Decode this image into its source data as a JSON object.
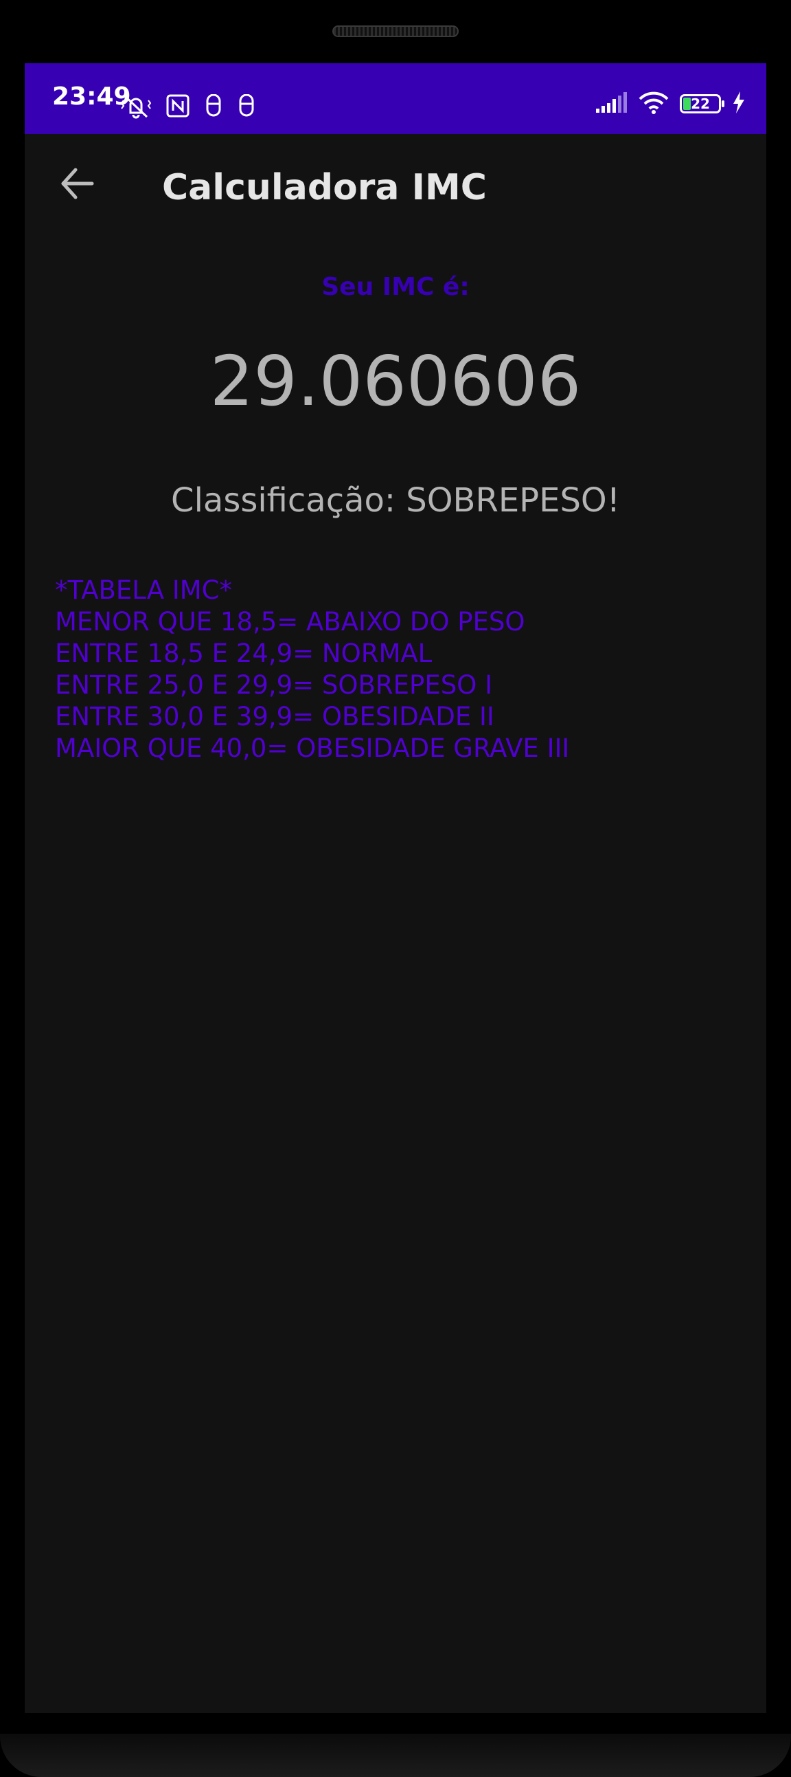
{
  "status_bar": {
    "time": "23:49",
    "battery_level": "22",
    "left_icons": [
      "vibrate-off-icon",
      "nfc-icon",
      "notification-icon",
      "notification-icon"
    ],
    "right_icons": [
      "signal-icon",
      "wifi-icon",
      "battery-icon",
      "charging-icon"
    ],
    "background_color": "#3700B3"
  },
  "app_bar": {
    "title": "Calculadora IMC"
  },
  "result": {
    "label": "Seu IMC é:",
    "value": "29.060606",
    "classification": "Classificação: SOBREPESO!"
  },
  "imc_table": {
    "header": "*TABELA IMC*",
    "rows": [
      "MENOR QUE 18,5= ABAIXO DO PESO",
      "ENTRE 18,5 E 24,9= NORMAL",
      "ENTRE 25,0 E 29,9= SOBREPESO I",
      "ENTRE 30,0 E 39,9= OBESIDADE II",
      "MAIOR QUE 40,0= OBESIDADE GRAVE III"
    ],
    "color": "#5000D0"
  }
}
